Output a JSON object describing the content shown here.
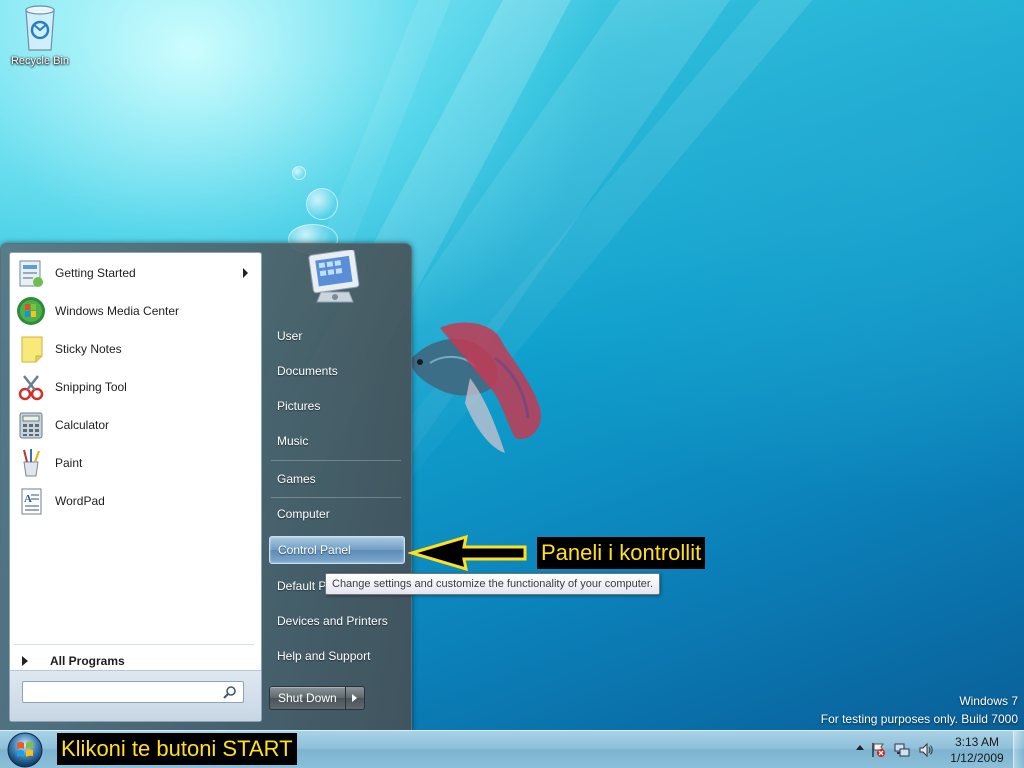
{
  "desktop": {
    "recycle_bin_label": "Recycle Bin",
    "watermark_line1": "Windows 7",
    "watermark_line2": "For testing purposes only. Build 7000"
  },
  "start_menu": {
    "programs": [
      {
        "label": "Getting Started",
        "icon": "getting-started-icon",
        "has_submenu": true
      },
      {
        "label": "Windows Media Center",
        "icon": "media-center-icon",
        "has_submenu": false
      },
      {
        "label": "Sticky Notes",
        "icon": "sticky-notes-icon",
        "has_submenu": false
      },
      {
        "label": "Snipping Tool",
        "icon": "snipping-tool-icon",
        "has_submenu": false
      },
      {
        "label": "Calculator",
        "icon": "calculator-icon",
        "has_submenu": false
      },
      {
        "label": "Paint",
        "icon": "paint-icon",
        "has_submenu": false
      },
      {
        "label": "WordPad",
        "icon": "wordpad-icon",
        "has_submenu": false
      }
    ],
    "all_programs_label": "All Programs",
    "search": {
      "placeholder": "",
      "value": ""
    },
    "right_links": [
      {
        "label": "User"
      },
      {
        "label": "Documents"
      },
      {
        "label": "Pictures"
      },
      {
        "label": "Music"
      },
      {
        "label": "Games"
      },
      {
        "label": "Computer"
      },
      {
        "label": "Control Panel",
        "highlighted": true
      },
      {
        "label": "Default Programs"
      },
      {
        "label": "Devices and Printers"
      },
      {
        "label": "Help and Support"
      }
    ],
    "shutdown_label": "Shut Down",
    "tooltip": "Change settings and customize the functionality of your computer."
  },
  "annotations": {
    "control_panel_label": "Paneli i kontrollit",
    "start_button_label": "Klikoni te butoni START",
    "color_text": "#ffe01a",
    "color_bg": "#000000"
  },
  "taskbar": {
    "time": "3:13 AM",
    "date": "1/12/2009",
    "tray_icons": [
      "show-hidden-icons",
      "action-center-flag-icon",
      "network-icon",
      "volume-icon"
    ]
  }
}
